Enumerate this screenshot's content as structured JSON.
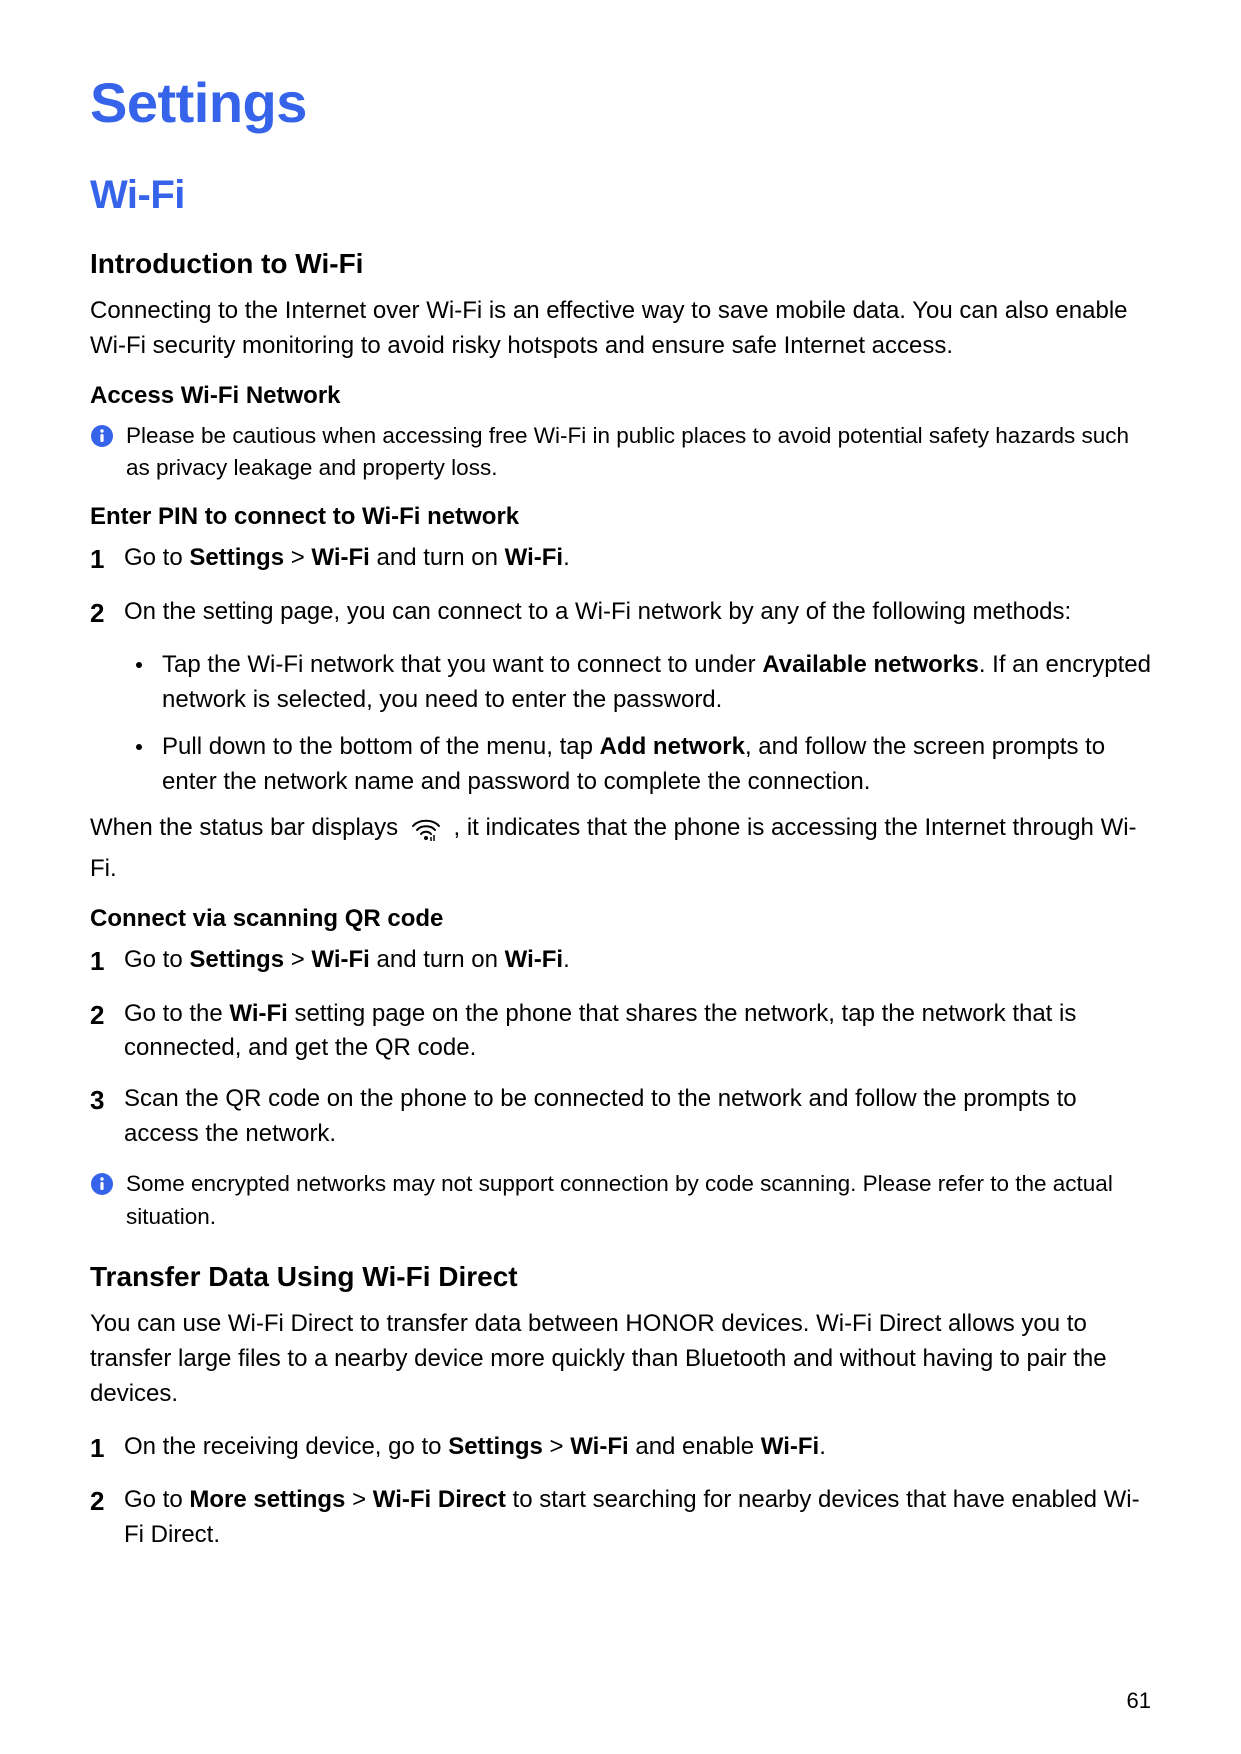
{
  "pageTitle": "Settings",
  "section": "Wi-Fi",
  "intro": {
    "heading": "Introduction to Wi-Fi",
    "body": "Connecting to the Internet over Wi-Fi is an effective way to save mobile data. You can also enable Wi-Fi security monitoring to avoid risky hotspots and ensure safe Internet access."
  },
  "accessHeading": "Access Wi-Fi Network",
  "accessInfo": "Please be cautious when accessing free Wi-Fi in public places to avoid potential safety hazards such as privacy leakage and property loss.",
  "pinHeading": "Enter PIN to connect to Wi-Fi network",
  "pinStep1": {
    "num": "1",
    "pre": "Go to ",
    "b1": "Settings",
    "gt": " > ",
    "b2": "Wi-Fi",
    "mid": " and turn on ",
    "b3": "Wi-Fi",
    "post": "."
  },
  "pinStep2": {
    "num": "2",
    "text": "On the setting page, you can connect to a Wi-Fi network by any of the following methods:"
  },
  "pinSub1": {
    "pre": "Tap the Wi-Fi network that you want to connect to under ",
    "b": "Available networks",
    "post": ". If an encrypted network is selected, you need to enter the password."
  },
  "pinSub2": {
    "pre": "Pull down to the bottom of the menu, tap ",
    "b": "Add network",
    "post": ", and follow the screen prompts to enter the network name and password to complete the connection."
  },
  "statusBar": {
    "pre": "When the status bar displays ",
    "post": ", it indicates that the phone is accessing the Internet through Wi-Fi."
  },
  "qrHeading": "Connect via scanning QR code",
  "qrStep1": {
    "num": "1",
    "pre": "Go to ",
    "b1": "Settings",
    "gt": " > ",
    "b2": "Wi-Fi",
    "mid": " and turn on ",
    "b3": "Wi-Fi",
    "post": "."
  },
  "qrStep2": {
    "num": "2",
    "pre": "Go to the ",
    "b": "Wi-Fi",
    "post": " setting page on the phone that shares the network, tap the network that is connected, and get the QR code."
  },
  "qrStep3": {
    "num": "3",
    "text": "Scan the QR code on the phone to be connected to the network and follow the prompts to access the network."
  },
  "qrInfo": "Some encrypted networks may not support connection by code scanning. Please refer to the actual situation.",
  "direct": {
    "heading": "Transfer Data Using Wi-Fi Direct",
    "body": "You can use Wi-Fi Direct to transfer data between HONOR devices. Wi-Fi Direct allows you to transfer large files to a nearby device more quickly than Bluetooth and without having to pair the devices."
  },
  "directStep1": {
    "num": "1",
    "pre": "On the receiving device, go to ",
    "b1": "Settings",
    "gt": " > ",
    "b2": "Wi-Fi",
    "mid": " and enable ",
    "b3": "Wi-Fi",
    "post": "."
  },
  "directStep2": {
    "num": "2",
    "pre": "Go to ",
    "b1": "More settings",
    "gt": " > ",
    "b2": "Wi-Fi Direct",
    "post": " to start searching for nearby devices that have enabled Wi-Fi Direct."
  },
  "pageNumber": "61"
}
